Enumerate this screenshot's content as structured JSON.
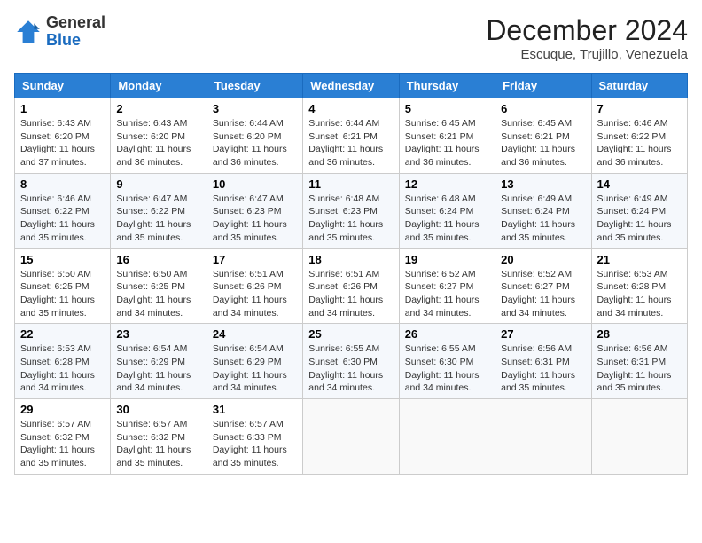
{
  "logo": {
    "general": "General",
    "blue": "Blue"
  },
  "title": "December 2024",
  "location": "Escuque, Trujillo, Venezuela",
  "days_of_week": [
    "Sunday",
    "Monday",
    "Tuesday",
    "Wednesday",
    "Thursday",
    "Friday",
    "Saturday"
  ],
  "weeks": [
    [
      {
        "day": "1",
        "sunrise": "6:43 AM",
        "sunset": "6:20 PM",
        "daylight": "11 hours and 37 minutes."
      },
      {
        "day": "2",
        "sunrise": "6:43 AM",
        "sunset": "6:20 PM",
        "daylight": "11 hours and 36 minutes."
      },
      {
        "day": "3",
        "sunrise": "6:44 AM",
        "sunset": "6:20 PM",
        "daylight": "11 hours and 36 minutes."
      },
      {
        "day": "4",
        "sunrise": "6:44 AM",
        "sunset": "6:21 PM",
        "daylight": "11 hours and 36 minutes."
      },
      {
        "day": "5",
        "sunrise": "6:45 AM",
        "sunset": "6:21 PM",
        "daylight": "11 hours and 36 minutes."
      },
      {
        "day": "6",
        "sunrise": "6:45 AM",
        "sunset": "6:21 PM",
        "daylight": "11 hours and 36 minutes."
      },
      {
        "day": "7",
        "sunrise": "6:46 AM",
        "sunset": "6:22 PM",
        "daylight": "11 hours and 36 minutes."
      }
    ],
    [
      {
        "day": "8",
        "sunrise": "6:46 AM",
        "sunset": "6:22 PM",
        "daylight": "11 hours and 35 minutes."
      },
      {
        "day": "9",
        "sunrise": "6:47 AM",
        "sunset": "6:22 PM",
        "daylight": "11 hours and 35 minutes."
      },
      {
        "day": "10",
        "sunrise": "6:47 AM",
        "sunset": "6:23 PM",
        "daylight": "11 hours and 35 minutes."
      },
      {
        "day": "11",
        "sunrise": "6:48 AM",
        "sunset": "6:23 PM",
        "daylight": "11 hours and 35 minutes."
      },
      {
        "day": "12",
        "sunrise": "6:48 AM",
        "sunset": "6:24 PM",
        "daylight": "11 hours and 35 minutes."
      },
      {
        "day": "13",
        "sunrise": "6:49 AM",
        "sunset": "6:24 PM",
        "daylight": "11 hours and 35 minutes."
      },
      {
        "day": "14",
        "sunrise": "6:49 AM",
        "sunset": "6:24 PM",
        "daylight": "11 hours and 35 minutes."
      }
    ],
    [
      {
        "day": "15",
        "sunrise": "6:50 AM",
        "sunset": "6:25 PM",
        "daylight": "11 hours and 35 minutes."
      },
      {
        "day": "16",
        "sunrise": "6:50 AM",
        "sunset": "6:25 PM",
        "daylight": "11 hours and 34 minutes."
      },
      {
        "day": "17",
        "sunrise": "6:51 AM",
        "sunset": "6:26 PM",
        "daylight": "11 hours and 34 minutes."
      },
      {
        "day": "18",
        "sunrise": "6:51 AM",
        "sunset": "6:26 PM",
        "daylight": "11 hours and 34 minutes."
      },
      {
        "day": "19",
        "sunrise": "6:52 AM",
        "sunset": "6:27 PM",
        "daylight": "11 hours and 34 minutes."
      },
      {
        "day": "20",
        "sunrise": "6:52 AM",
        "sunset": "6:27 PM",
        "daylight": "11 hours and 34 minutes."
      },
      {
        "day": "21",
        "sunrise": "6:53 AM",
        "sunset": "6:28 PM",
        "daylight": "11 hours and 34 minutes."
      }
    ],
    [
      {
        "day": "22",
        "sunrise": "6:53 AM",
        "sunset": "6:28 PM",
        "daylight": "11 hours and 34 minutes."
      },
      {
        "day": "23",
        "sunrise": "6:54 AM",
        "sunset": "6:29 PM",
        "daylight": "11 hours and 34 minutes."
      },
      {
        "day": "24",
        "sunrise": "6:54 AM",
        "sunset": "6:29 PM",
        "daylight": "11 hours and 34 minutes."
      },
      {
        "day": "25",
        "sunrise": "6:55 AM",
        "sunset": "6:30 PM",
        "daylight": "11 hours and 34 minutes."
      },
      {
        "day": "26",
        "sunrise": "6:55 AM",
        "sunset": "6:30 PM",
        "daylight": "11 hours and 34 minutes."
      },
      {
        "day": "27",
        "sunrise": "6:56 AM",
        "sunset": "6:31 PM",
        "daylight": "11 hours and 35 minutes."
      },
      {
        "day": "28",
        "sunrise": "6:56 AM",
        "sunset": "6:31 PM",
        "daylight": "11 hours and 35 minutes."
      }
    ],
    [
      {
        "day": "29",
        "sunrise": "6:57 AM",
        "sunset": "6:32 PM",
        "daylight": "11 hours and 35 minutes."
      },
      {
        "day": "30",
        "sunrise": "6:57 AM",
        "sunset": "6:32 PM",
        "daylight": "11 hours and 35 minutes."
      },
      {
        "day": "31",
        "sunrise": "6:57 AM",
        "sunset": "6:33 PM",
        "daylight": "11 hours and 35 minutes."
      },
      null,
      null,
      null,
      null
    ]
  ],
  "labels": {
    "sunrise": "Sunrise:",
    "sunset": "Sunset:",
    "daylight": "Daylight:"
  }
}
